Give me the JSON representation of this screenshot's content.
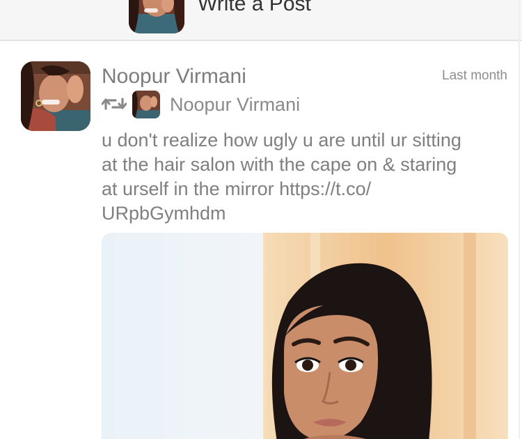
{
  "composer": {
    "label": "Write a Post",
    "avatar_icon": "user-avatar-photo"
  },
  "tweet": {
    "author_name": "Noopur Virmani",
    "timestamp": "Last month",
    "retweet": {
      "icon": "retweet-icon",
      "name": "Noopur Virmani"
    },
    "text": "u don't realize how ugly u are until ur sitting\nat the hair salon with the cape on & staring\nat urself in the mirror https://t.co/\nURpbGymhdm",
    "media": {
      "kind": "photo"
    }
  },
  "colors": {
    "composer_bg": "#f6f6f6",
    "divider": "#e3e3e3",
    "text_gray": "#7f7f7f",
    "icon_gray": "#8a8a8a"
  }
}
